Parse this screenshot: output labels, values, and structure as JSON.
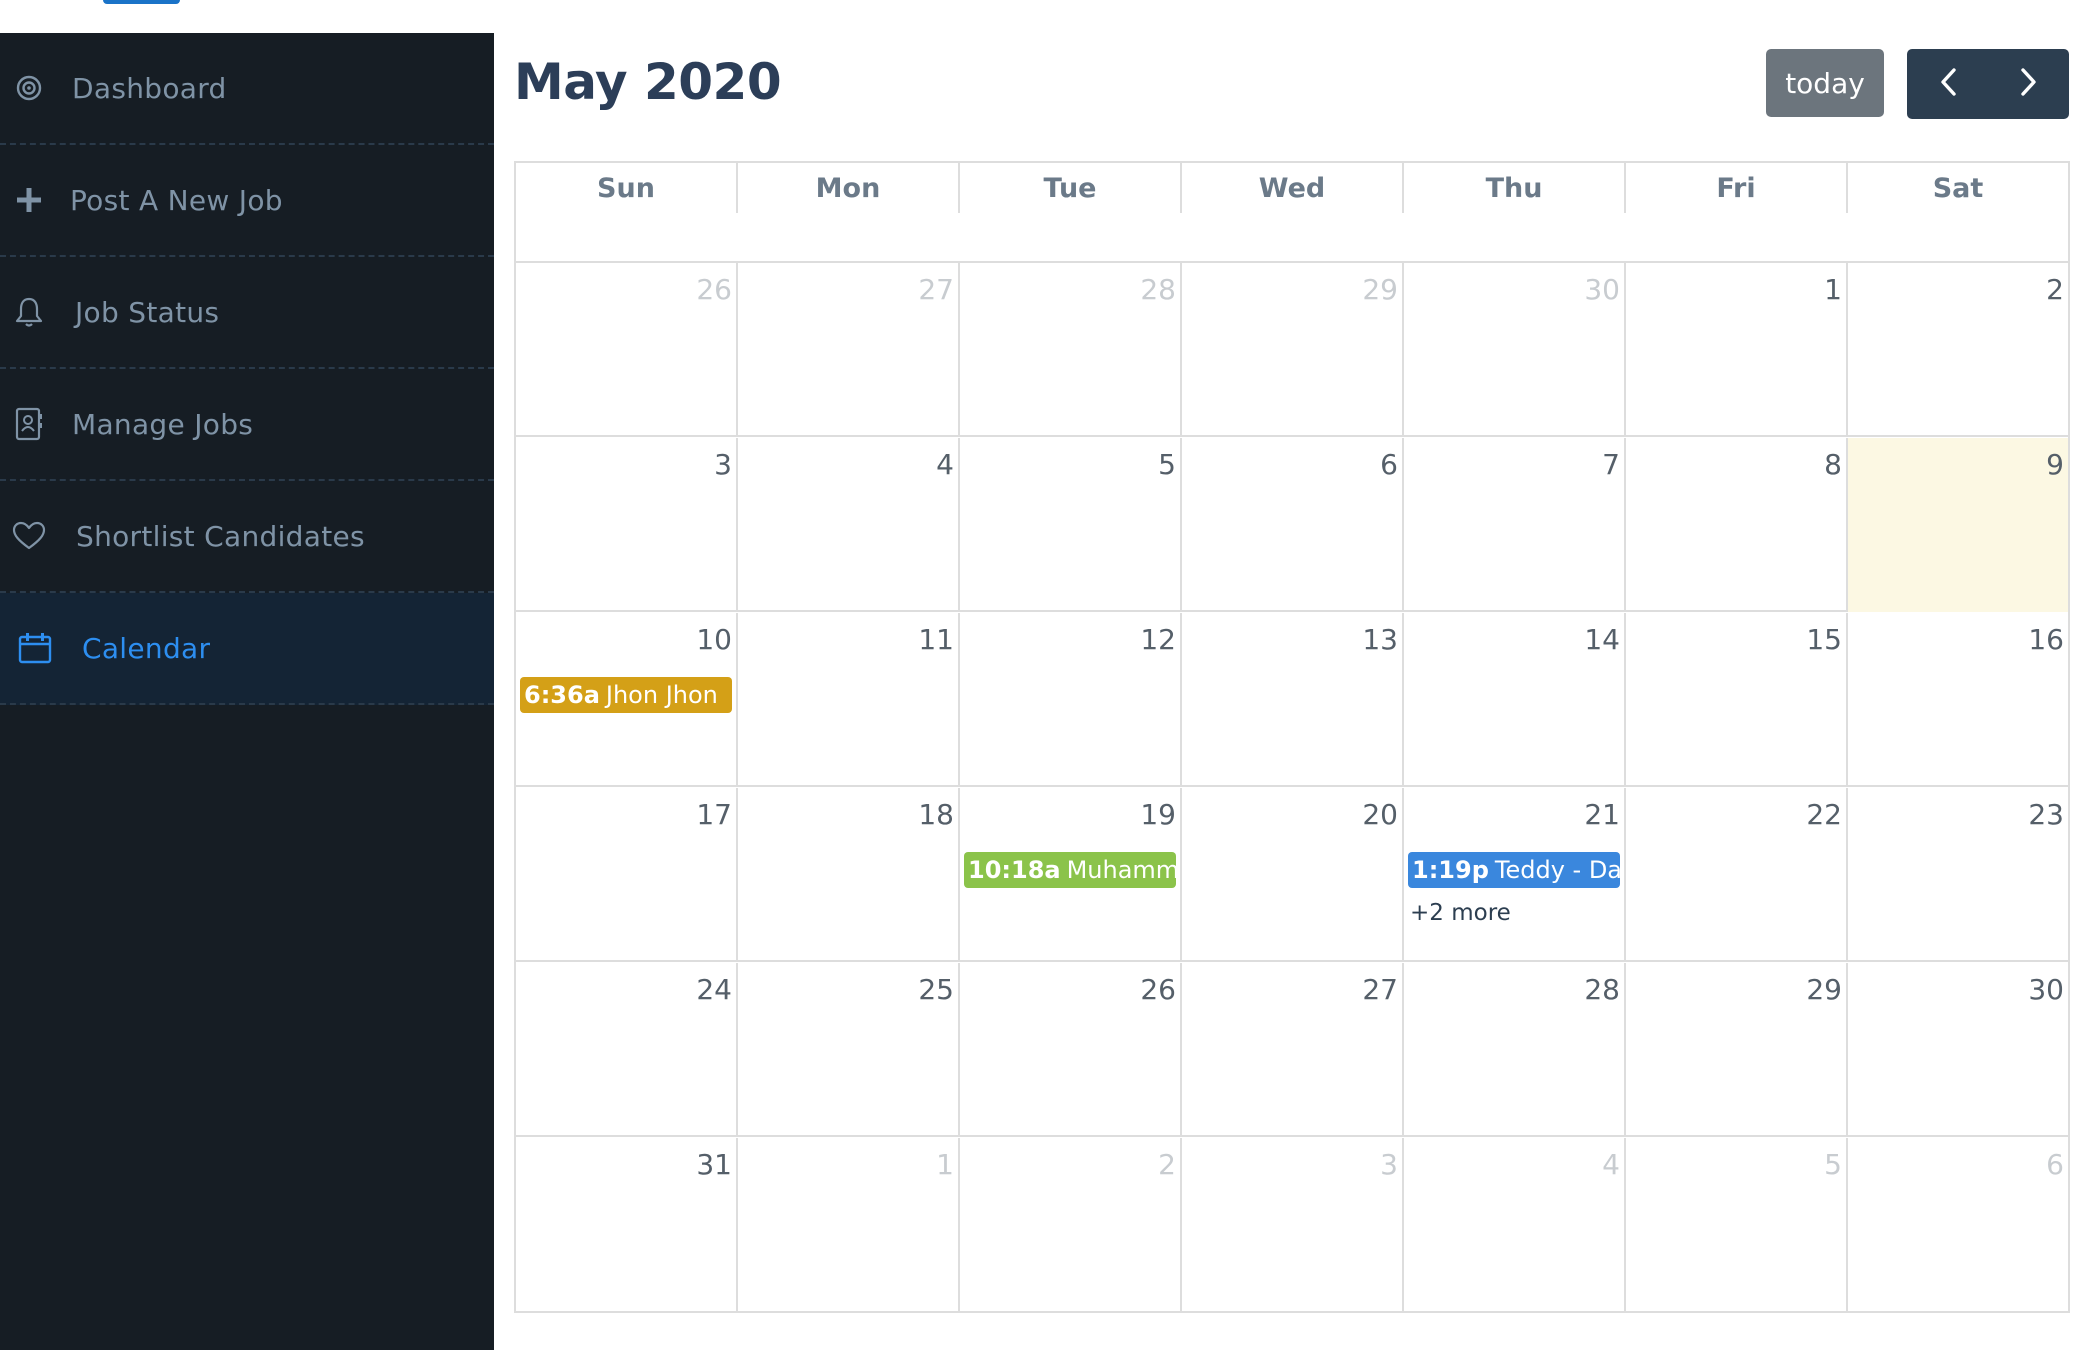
{
  "sidebar": {
    "items": [
      {
        "label": "Dashboard",
        "icon": "target-icon"
      },
      {
        "label": "Post A New Job",
        "icon": "plus-icon"
      },
      {
        "label": "Job Status",
        "icon": "bell-icon"
      },
      {
        "label": "Manage Jobs",
        "icon": "contact-book-icon"
      },
      {
        "label": "Shortlist Candidates",
        "icon": "heart-icon"
      },
      {
        "label": "Calendar",
        "icon": "calendar-icon",
        "active": true
      }
    ]
  },
  "calendar": {
    "title": "May 2020",
    "today_label": "today",
    "prev_icon": "chevron-left-icon",
    "next_icon": "chevron-right-icon",
    "weekdays": [
      "Sun",
      "Mon",
      "Tue",
      "Wed",
      "Thu",
      "Fri",
      "Sat"
    ],
    "weeks": [
      [
        "26",
        "27",
        "28",
        "29",
        "30",
        "1",
        "2"
      ],
      [
        "3",
        "4",
        "5",
        "6",
        "7",
        "8",
        "9"
      ],
      [
        "10",
        "11",
        "12",
        "13",
        "14",
        "15",
        "16"
      ],
      [
        "17",
        "18",
        "19",
        "20",
        "21",
        "22",
        "23"
      ],
      [
        "24",
        "25",
        "26",
        "27",
        "28",
        "29",
        "30"
      ],
      [
        "31",
        "1",
        "2",
        "3",
        "4",
        "5",
        "6"
      ]
    ],
    "events": [
      {
        "time": "6:36a",
        "title": "Jhon Jhon",
        "color": "#d4a017"
      },
      {
        "time": "10:18a",
        "title": "Muhammad",
        "color": "#8bc34a"
      },
      {
        "time": "1:19p",
        "title": "Teddy - Data",
        "color": "#3a87dd"
      }
    ],
    "more_label": "+2 more",
    "colors": {
      "today_bg": "#fcf8e3",
      "header_btn": "#2c3e50",
      "today_btn": "#6c757d",
      "active_nav": "#2d8ef0"
    }
  }
}
